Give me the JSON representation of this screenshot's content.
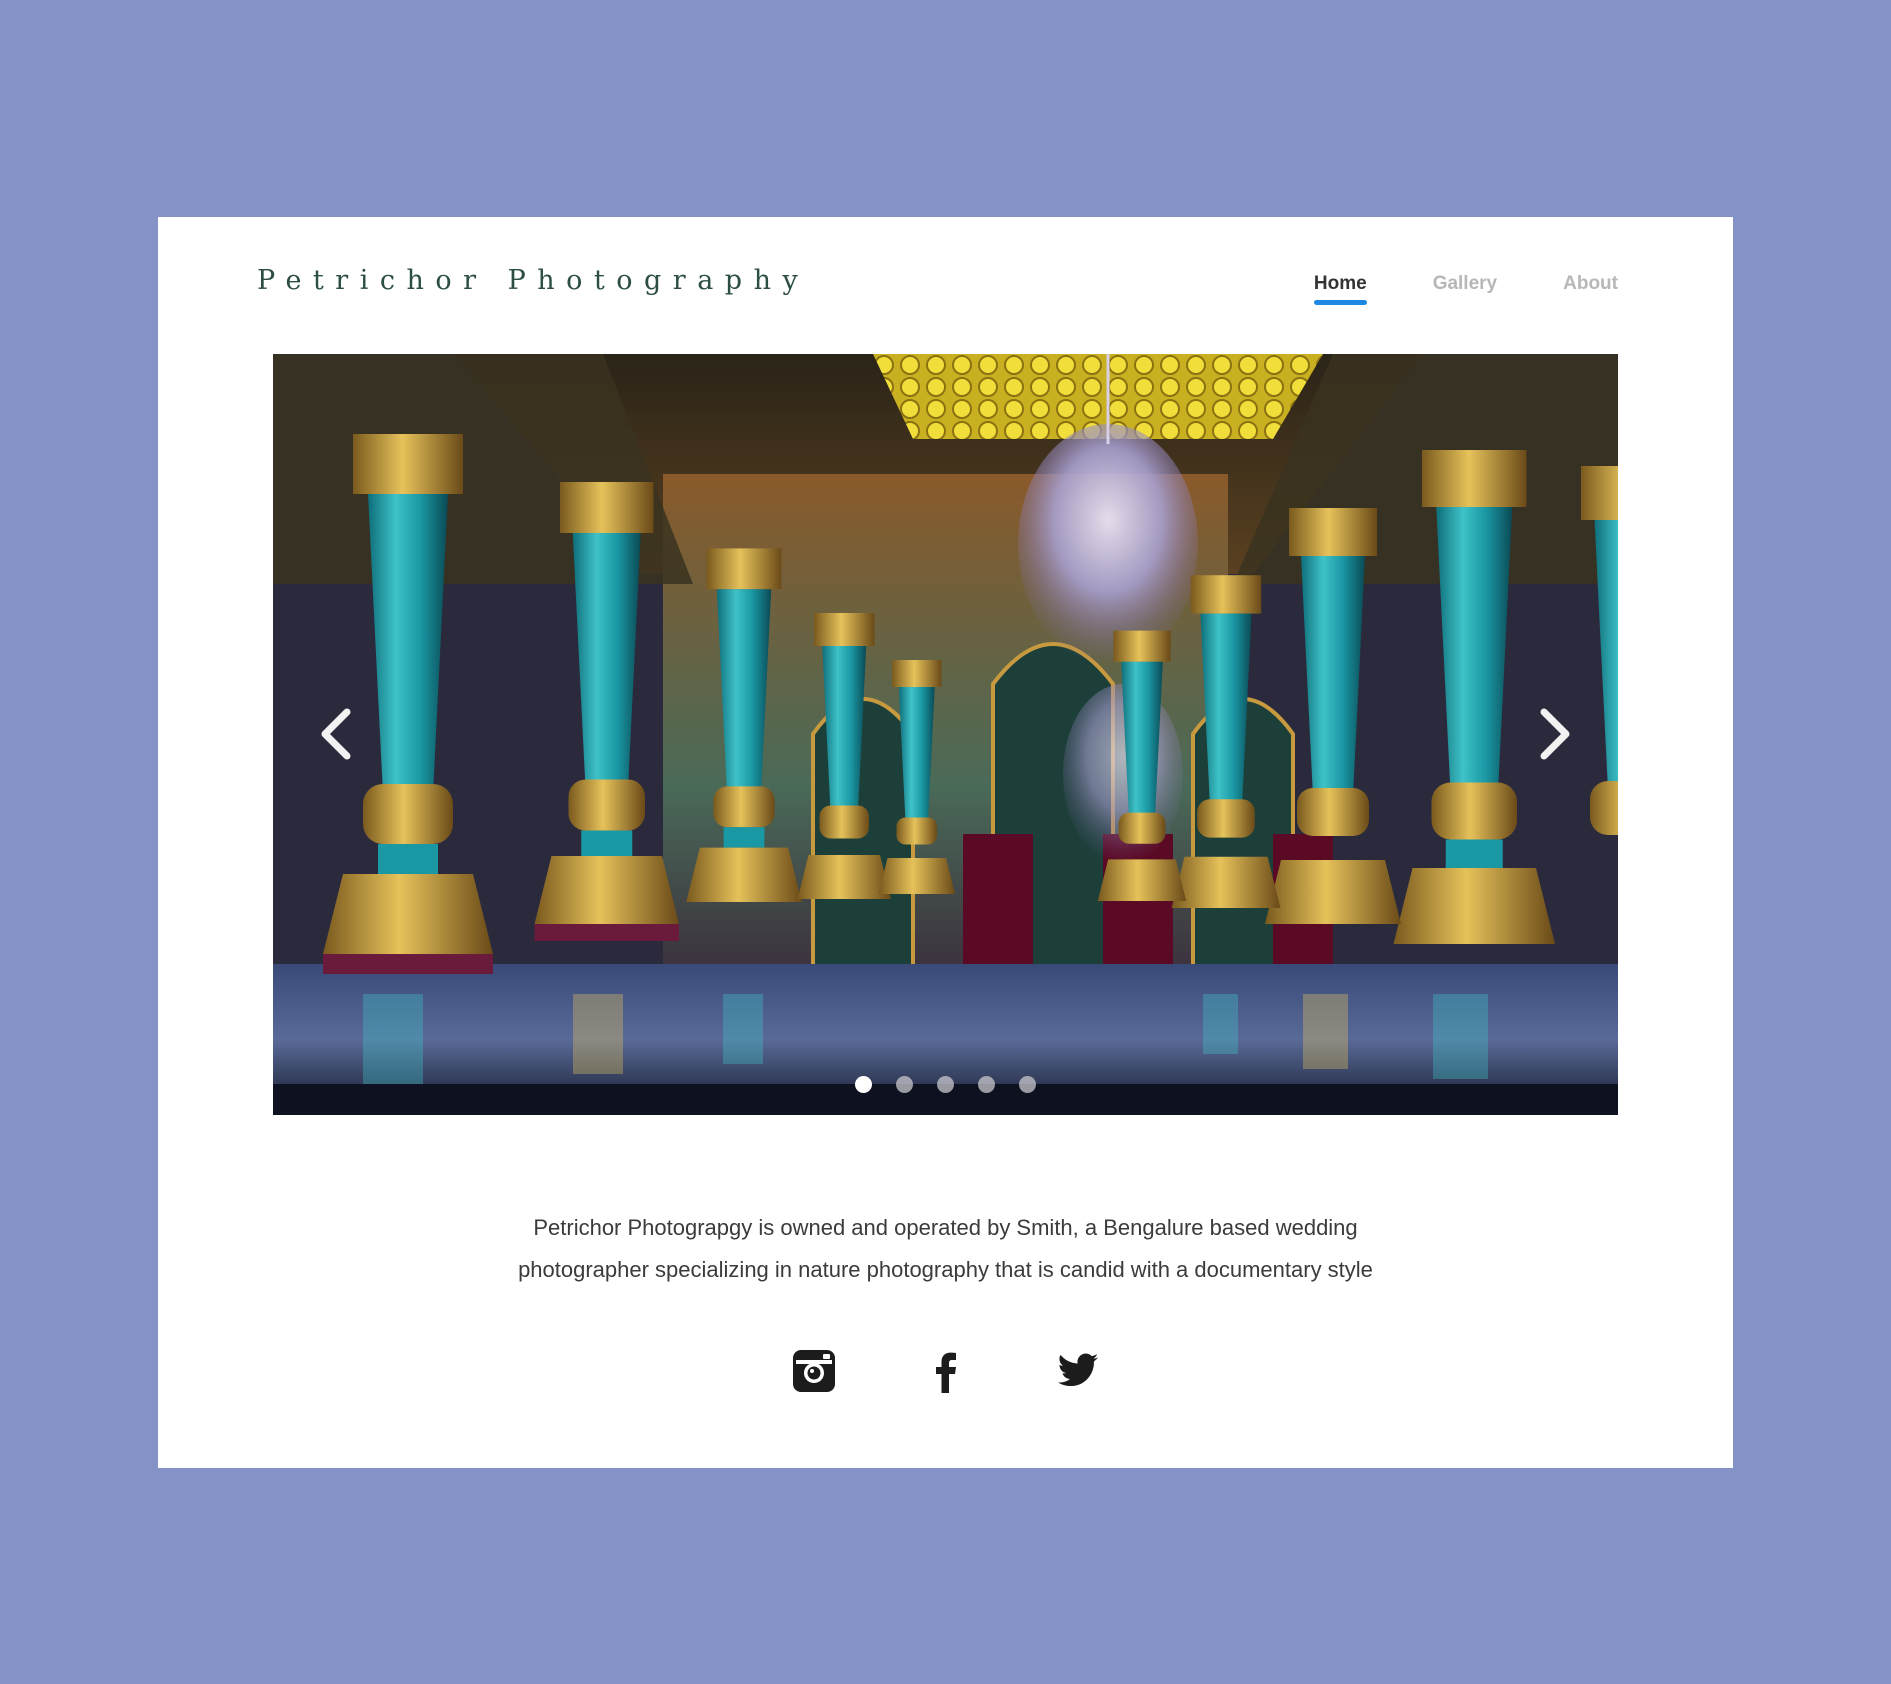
{
  "header": {
    "brand": "Petrichor Photography"
  },
  "nav": {
    "items": [
      {
        "label": "Home",
        "active": true
      },
      {
        "label": "Gallery",
        "active": false
      },
      {
        "label": "About",
        "active": false
      }
    ]
  },
  "slider": {
    "prev_icon": "chevron-left-icon",
    "next_icon": "chevron-right-icon",
    "slide_count": 5,
    "active_index": 0
  },
  "about": {
    "line1": "Petrichor Photograpgy is owned and operated by Smith, a Bengalure based wedding",
    "line2": "photographer specializing in nature photography that is candid with a documentary style"
  },
  "social": {
    "icons": [
      "instagram-icon",
      "facebook-icon",
      "twitter-icon"
    ]
  },
  "colors": {
    "background": "#8492c8",
    "card": "#ffffff",
    "brand_text": "#2d4e42",
    "nav_active": "#333333",
    "nav_inactive": "#b7b7b7",
    "nav_underline": "#1e88e5",
    "body_text": "#3b3b3b",
    "icon": "#1c1c1c"
  }
}
